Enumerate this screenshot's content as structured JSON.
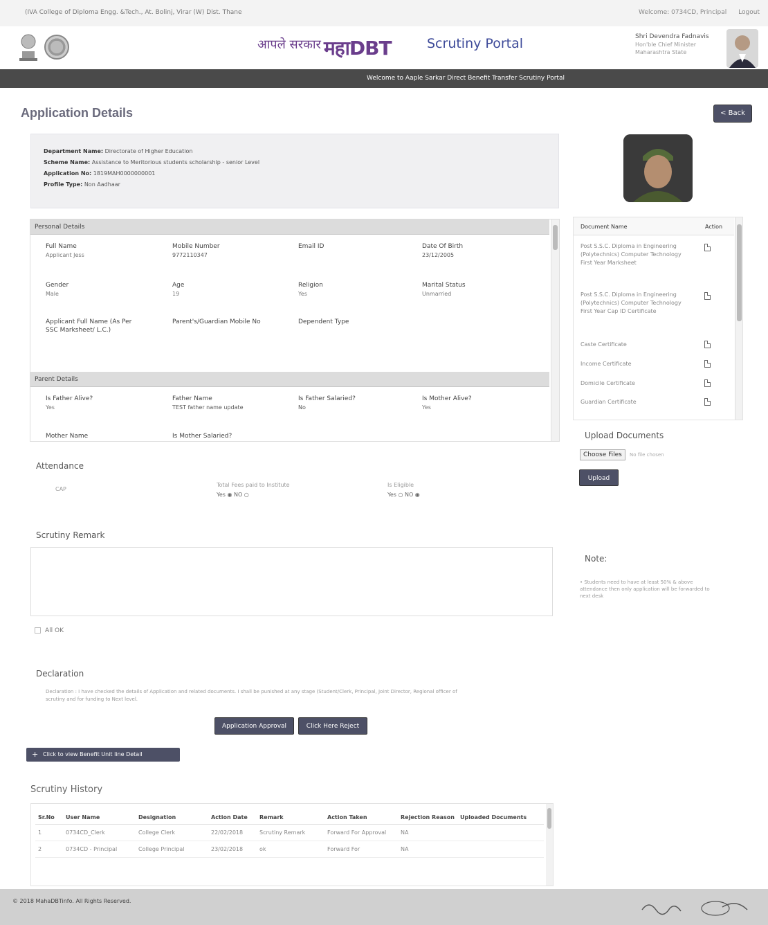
{
  "topbar": {
    "college": "(IVA College of Diploma Engg. &Tech., At. Bolinj, Virar (W) Dist. Thane",
    "user": "Welcome: 0734CD, Principal",
    "logout": "Logout"
  },
  "header": {
    "brand_hindi_1": "आपले सरकार",
    "brand_hindi_2": "महाDBT",
    "portal_title": "Scrutiny Portal",
    "cm_name": "Shri Devendra Fadnavis",
    "cm_title1": "Hon'ble Chief Minister",
    "cm_title2": "Maharashtra State"
  },
  "welcome_banner": "Welcome to Aaple Sarkar Direct Benefit Transfer Scrutiny Portal",
  "page": {
    "title": "Application Details",
    "back_button": "< Back"
  },
  "application": {
    "department_label": "Department Name:",
    "department_value": "Directorate of Higher Education",
    "scheme_label": "Scheme Name:",
    "scheme_value": "Assistance to Meritorious students scholarship - senior Level",
    "appno_label": "Application No:",
    "appno_value": "1819MAH0000000001",
    "profile_label": "Profile Type:",
    "profile_value": "Non Aadhaar"
  },
  "personal": {
    "section_title": "Personal Details",
    "full_name_label": "Full Name",
    "full_name_value": "Applicant Jess",
    "mobile_label": "Mobile Number",
    "mobile_value": "9772110347",
    "email_label": "Email ID",
    "dob_label": "Date Of Birth",
    "dob_value": "23/12/2005",
    "gender_label": "Gender",
    "gender_value": "Male",
    "age_label": "Age",
    "age_value": "19",
    "religion_label": "Religion",
    "religion_value": "Yes",
    "marital_label": "Marital Status",
    "marital_value": "Unmarried",
    "ssc_name_label_1": "Applicant Full Name (As Per",
    "ssc_name_label_2": "SSC Marksheet/ L.C.)",
    "guardian_mobile_label": "Parent's/Guardian Mobile No",
    "dependent_label": "Dependent Type"
  },
  "parent": {
    "section_title": "Parent Details",
    "father_alive_label": "Is Father Alive?",
    "father_alive_value": "Yes",
    "father_name_label": "Father Name",
    "father_name_value": "TEST father name update",
    "father_salaried_label": "Is Father Salaried?",
    "father_salaried_value": "No",
    "mother_alive_label": "Is Mother Alive?",
    "mother_alive_value": "Yes",
    "mother_name_label": "Mother Name",
    "mother_salaried_label": "Is Mother Salaried?"
  },
  "documents": {
    "col_name": "Document Name",
    "col_action": "Action",
    "items": [
      "Post S.S.C. Diploma in Engineering (Polytechnics) Computer Technology First Year Marksheet",
      "Post S.S.C. Diploma in Engineering (Polytechnics) Computer Technology First Year Cap ID Certificate",
      "Caste Certificate",
      "Income Certificate",
      "Domicile Certificate",
      "Guardian Certificate"
    ]
  },
  "upload": {
    "title": "Upload Documents",
    "choose_btn": "Choose Files",
    "choose_status": "No file chosen",
    "upload_btn": "Upload"
  },
  "attendance": {
    "title": "Attendance",
    "item": "CAP",
    "fees_label": "Total Fees paid to Institute",
    "fees_options": "Yes ◉ NO ○",
    "eligible_label": "Is Eligible",
    "eligible_options": "Yes ○ NO ◉"
  },
  "scrutiny": {
    "title": "Scrutiny Remark",
    "all_ok": "All OK"
  },
  "note": {
    "title": "Note:",
    "text": "• Students need to have at least 50% & above attendance then only application will be forwarded to next desk"
  },
  "declaration": {
    "title": "Declaration",
    "text": "Declaration : I have checked the details of Application and related documents. I shall be punished at any stage (Student/Clerk, Principal, Joint Director, Regional officer of scrutiny and for funding to Next level.",
    "btn_forward": "Application Approval",
    "btn_reject": "Click Here Reject"
  },
  "bank_details_btn": "Click to view Benefit Unit line Detail",
  "history": {
    "title": "Scrutiny History",
    "columns": [
      "Sr.No",
      "User Name",
      "Designation",
      "Action Date",
      "Remark",
      "Action Taken",
      "Rejection Reason",
      "Uploaded Documents"
    ],
    "rows": [
      [
        "1",
        "0734CD_Clerk",
        "College Clerk",
        "22/02/2018",
        "Scrutiny Remark",
        "Forward For Approval",
        "NA",
        ""
      ],
      [
        "2",
        "0734CD - Principal",
        "College Principal",
        "23/02/2018",
        "ok",
        "Forward For",
        "NA",
        ""
      ]
    ]
  },
  "footer": {
    "copyright": "© 2018 MahaDBTinfo. All Rights Reserved."
  }
}
